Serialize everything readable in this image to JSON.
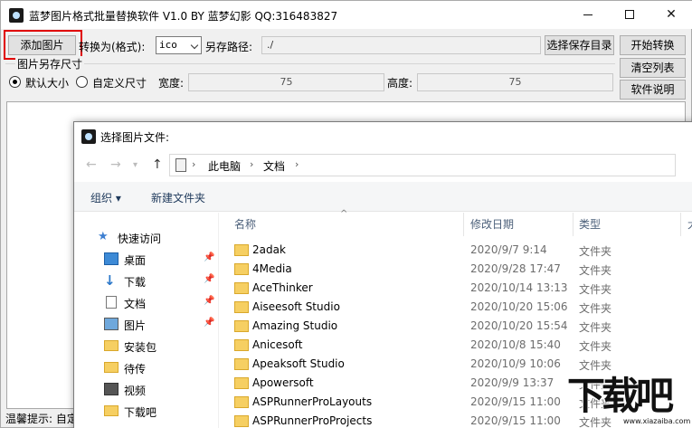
{
  "main_window": {
    "title": "蓝梦图片格式批量替换软件 V1.0 BY 蓝梦幻影 QQ:316483827",
    "controls": {
      "minimize": "min",
      "maximize": "max",
      "close": "✕"
    },
    "toolbar": {
      "add_images_label": "添加图片",
      "convert_to_label": "转换为(格式):",
      "format_selected": "ico",
      "save_path_label": "另存路径:",
      "save_path_value": "./",
      "choose_dir_label": "选择保存目录",
      "start_label": "开始转换",
      "clear_label": "清空列表",
      "help_label": "软件说明"
    },
    "resize_group": {
      "label": "图片另存尺寸",
      "default_size_label": "默认大小",
      "custom_size_label": "自定义尺寸",
      "selected": "default",
      "width_label": "宽度:",
      "width_value": "75",
      "height_label": "高度:",
      "height_value": "75"
    },
    "status_text": "温馨提示: 自定"
  },
  "file_dialog": {
    "title": "选择图片文件:",
    "breadcrumb": [
      "此电脑",
      "文档"
    ],
    "toolbar": {
      "organize_label": "组织 ▾",
      "new_folder_label": "新建文件夹"
    },
    "nav_pane": [
      {
        "label": "快速访问",
        "icon": "star-icon",
        "pinned": false
      },
      {
        "label": "桌面",
        "icon": "desktop-icon",
        "pinned": true
      },
      {
        "label": "下载",
        "icon": "download-icon",
        "pinned": true
      },
      {
        "label": "文档",
        "icon": "document-icon",
        "pinned": true
      },
      {
        "label": "图片",
        "icon": "pictures-icon",
        "pinned": true
      },
      {
        "label": "安装包",
        "icon": "folder-icon",
        "pinned": false
      },
      {
        "label": "待传",
        "icon": "folder-icon",
        "pinned": false
      },
      {
        "label": "视频",
        "icon": "video-icon",
        "pinned": false
      },
      {
        "label": "下载吧",
        "icon": "folder-icon",
        "pinned": false
      }
    ],
    "columns": [
      "名称",
      "修改日期",
      "类型",
      "大"
    ],
    "files": [
      {
        "name": "2adak",
        "date": "2020/9/7 9:14",
        "type": "文件夹"
      },
      {
        "name": "4Media",
        "date": "2020/9/28 17:47",
        "type": "文件夹"
      },
      {
        "name": "AceThinker",
        "date": "2020/10/14 13:13",
        "type": "文件夹"
      },
      {
        "name": "Aiseesoft Studio",
        "date": "2020/10/20 15:06",
        "type": "文件夹"
      },
      {
        "name": "Amazing Studio",
        "date": "2020/10/20 15:54",
        "type": "文件夹"
      },
      {
        "name": "Anicesoft",
        "date": "2020/10/8 15:40",
        "type": "文件夹"
      },
      {
        "name": "Apeaksoft Studio",
        "date": "2020/10/9 10:06",
        "type": "文件夹"
      },
      {
        "name": "Apowersoft",
        "date": "2020/9/9 13:37",
        "type": "文件夹"
      },
      {
        "name": "ASPRunnerProLayouts",
        "date": "2020/9/15 11:00",
        "type": "文件夹"
      },
      {
        "name": "ASPRunnerProProjects",
        "date": "2020/9/15 11:00",
        "type": "文件夹"
      }
    ]
  },
  "watermark": {
    "logo_text": "下载吧",
    "url": "www.xiazaiba.com"
  },
  "colors": {
    "highlight": "#e00000",
    "folder": "#f6cf62",
    "header_text": "#4c607a"
  }
}
